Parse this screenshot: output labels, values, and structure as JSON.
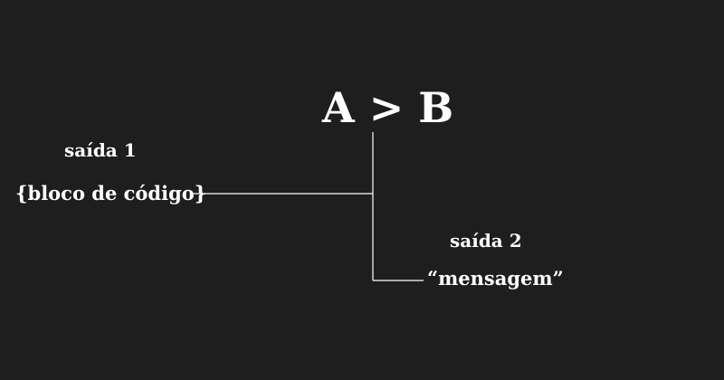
{
  "diagram": {
    "condition": "A > B",
    "branch_1": {
      "label": "saída 1",
      "content": "{bloco de código}"
    },
    "branch_2": {
      "label": "saída 2",
      "content": "“mensagem”"
    }
  },
  "colors": {
    "background": "#1e1e1e",
    "foreground": "#ffffff"
  }
}
